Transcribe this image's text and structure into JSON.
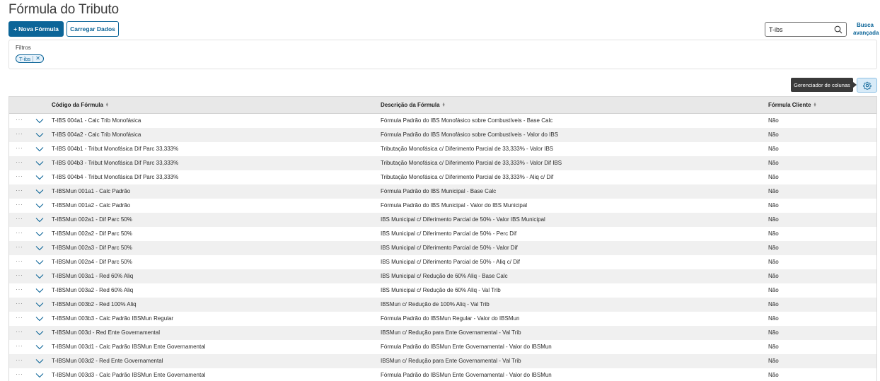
{
  "page": {
    "title": "Fórmula do Tributo"
  },
  "toolbar": {
    "new_formula_label": "Nova Fórmula",
    "new_formula_plus": "+",
    "load_data_label": "Carregar Dados"
  },
  "search": {
    "value": "T-ibs",
    "advanced_line1": "Busca",
    "advanced_line2": "avançada"
  },
  "filters": {
    "label": "Filtros",
    "chips": [
      {
        "label": "T-ibs"
      }
    ]
  },
  "column_manager": {
    "tooltip": "Gerenciador de colunas"
  },
  "table": {
    "columns": [
      {
        "label": "Código da Fórmula"
      },
      {
        "label": "Descrição da Fórmula"
      },
      {
        "label": "Fórmula Cliente"
      }
    ],
    "rows": [
      {
        "code": "T-IBS 004a1 - Calc Trib Monofásica",
        "description": "Fórmula Padrão do IBS Monofásico sobre Combustíveis - Base Calc",
        "client": "Não"
      },
      {
        "code": "T-IBS 004a2 - Calc Trib Monofásica",
        "description": "Fórmula Padrão do IBS Monofásico sobre Combustíveis - Valor do IBS",
        "client": "Não"
      },
      {
        "code": "T-IBS 004b1 - Tribut Monofásica Dif Parc 33,333%",
        "description": "Tributação Monofásica c/ Diferimento Parcial de 33,333% - Valor IBS",
        "client": "Não"
      },
      {
        "code": "T-IBS 004b3 - Tribut Monofásica Dif Parc 33,333%",
        "description": "Tributação Monofásica c/ Diferimento Parcial de 33,333% - Valor Dif IBS",
        "client": "Não"
      },
      {
        "code": "T-IBS 004b4 - Tribut Monofásica Dif Parc 33,333%",
        "description": "Tributação Monofásica c/ Diferimento Parcial de 33,333% - Aliq c/ Dif",
        "client": "Não"
      },
      {
        "code": "T-IBSMun 001a1 - Calc Padrão",
        "description": "Fórmula Padrão do IBS Municipal - Base Calc",
        "client": "Não"
      },
      {
        "code": "T-IBSMun 001a2 - Calc Padrão",
        "description": "Fórmula Padrão do IBS Municipal - Valor do IBS Municipal",
        "client": "Não"
      },
      {
        "code": "T-IBSMun 002a1 - Dif Parc 50%",
        "description": "IBS Municipal c/ Diferimento Parcial de 50% - Valor IBS Municipal",
        "client": "Não"
      },
      {
        "code": "T-IBSMun 002a2 - Dif Parc 50%",
        "description": "IBS Municipal c/ Diferimento Parcial de 50% - Perc Dif",
        "client": "Não"
      },
      {
        "code": "T-IBSMun 002a3 - Dif Parc 50%",
        "description": "IBS Municipal c/ Diferimento Parcial de 50% - Valor Dif",
        "client": "Não"
      },
      {
        "code": "T-IBSMun 002a4 - Dif Parc 50%",
        "description": "IBS Municipal c/ Diferimento Parcial de 50% - Aliq c/ Dif",
        "client": "Não"
      },
      {
        "code": "T-IBSMun 003a1 - Red 60% Aliq",
        "description": "IBS Municipal c/ Redução de 60% Aliq - Base Calc",
        "client": "Não"
      },
      {
        "code": "T-IBSMun 003a2 - Red 60% Aliq",
        "description": "IBS Municipal c/ Redução de 60% Aliq - Val Trib",
        "client": "Não"
      },
      {
        "code": "T-IBSMun 003b2 - Red 100% Aliq",
        "description": "IBSMun c/ Redução de 100% Aliq - Val Trib",
        "client": "Não"
      },
      {
        "code": "T-IBSMun 003b3 - Calc Padrão IBSMun Regular",
        "description": "Fórmula Padrão do IBSMun Regular - Valor do IBSMun",
        "client": "Não"
      },
      {
        "code": "T-IBSMun 003d - Red Ente Governamental",
        "description": "IBSMun c/ Redução para Ente Governamental - Val Trib",
        "client": "Não"
      },
      {
        "code": "T-IBSMun 003d1 - Calc Padrão IBSMun Ente Governamental",
        "description": "Fórmula Padrão do IBSMun Ente Governamental - Valor do IBSMun",
        "client": "Não"
      },
      {
        "code": "T-IBSMun 003d2 - Red Ente Governamental",
        "description": "IBSMun c/ Redução para Ente Governamental - Val Trib",
        "client": "Não"
      },
      {
        "code": "T-IBSMun 003d3 - Calc Padrão IBSMun Ente Governamental",
        "description": "Fórmula Padrão do IBSMun Ente Governamental - Valor do IBSMun",
        "client": "Não"
      }
    ],
    "row_actions_glyph": "···"
  },
  "colors": {
    "primary": "#0c6598",
    "header_bg": "#e8e8e8",
    "alt_row": "#f0f0f0",
    "tooltip_bg": "#3a3a3a"
  }
}
